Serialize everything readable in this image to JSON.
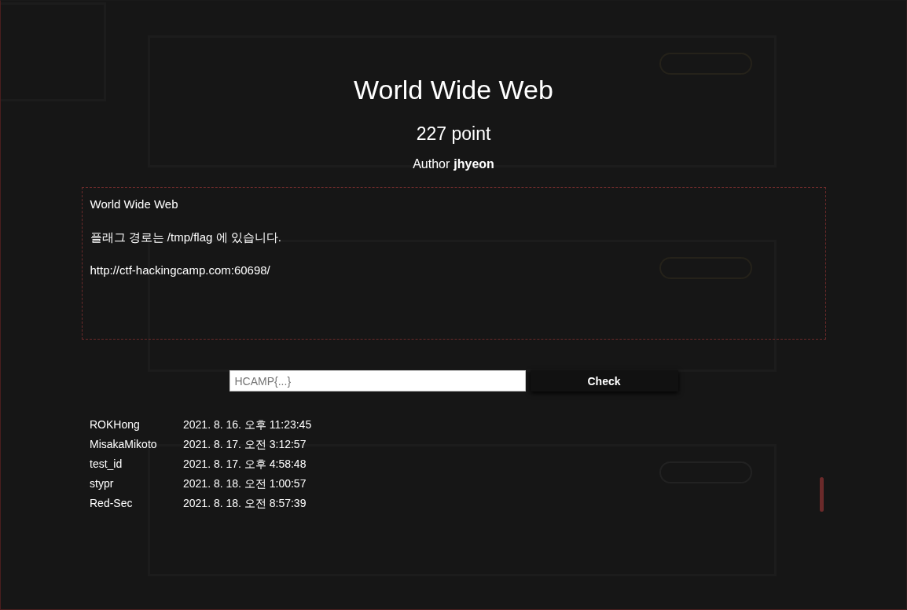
{
  "background": {
    "challenges": [
      {
        "color": "#25221a"
      },
      {
        "color": "#25221a"
      },
      {
        "color": "#222222"
      }
    ]
  },
  "modal": {
    "title": "World Wide Web",
    "points": "227 point",
    "author_label": "Author",
    "author": "jhyeon",
    "description": [
      "World Wide Web",
      "플래그 경로는 /tmp/flag 에 있습니다.",
      "http://ctf-hackingcamp.com:60698/"
    ],
    "flag_field": {
      "placeholder": "HCAMP{...}"
    },
    "check_button": "Check",
    "solves": [
      {
        "name": "ROKHong",
        "time": "2021. 8. 16. 오후 11:23:45"
      },
      {
        "name": "MisakaMikoto",
        "time": "2021. 8. 17. 오전 3:12:57"
      },
      {
        "name": "test_id",
        "time": "2021. 8. 17. 오후 4:58:48"
      },
      {
        "name": "stypr",
        "time": "2021. 8. 18. 오전 1:00:57"
      },
      {
        "name": "Red-Sec",
        "time": "2021. 8. 18. 오전 8:57:39"
      }
    ]
  }
}
